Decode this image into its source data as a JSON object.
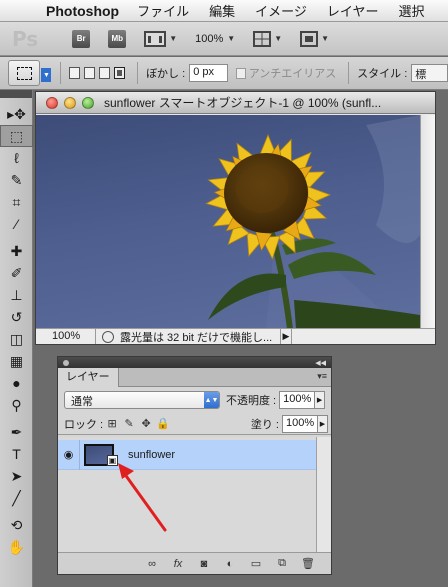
{
  "menubar": {
    "app_name": "Photoshop",
    "menus": [
      "ファイル",
      "編集",
      "イメージ",
      "レイヤー",
      "選択"
    ]
  },
  "appbar": {
    "ps_label": "Ps",
    "bridge_label": "Br",
    "mini_bridge_label": "Mb",
    "zoom_value": "100%"
  },
  "options": {
    "feather_label": "ぼかし :",
    "feather_value": "0 px",
    "antialias_label": "アンチエイリアス",
    "style_label": "スタイル :",
    "style_value": "標"
  },
  "document": {
    "title": "sunflower スマートオブジェクト-1 @ 100% (sunfl...",
    "zoom": "100%",
    "status_text": "露光量は 32 bit だけで機能し..."
  },
  "layers_panel": {
    "tab_label": "レイヤー",
    "blend_mode": "通常",
    "opacity_label": "不透明度 :",
    "opacity_value": "100%",
    "lock_label": "ロック :",
    "fill_label": "塗り :",
    "fill_value": "100%",
    "layer_name": "sunflower"
  },
  "colors": {
    "sky": "#4a5b8c",
    "selection": "#b5d3fa",
    "annotation_arrow": "#e02020"
  }
}
